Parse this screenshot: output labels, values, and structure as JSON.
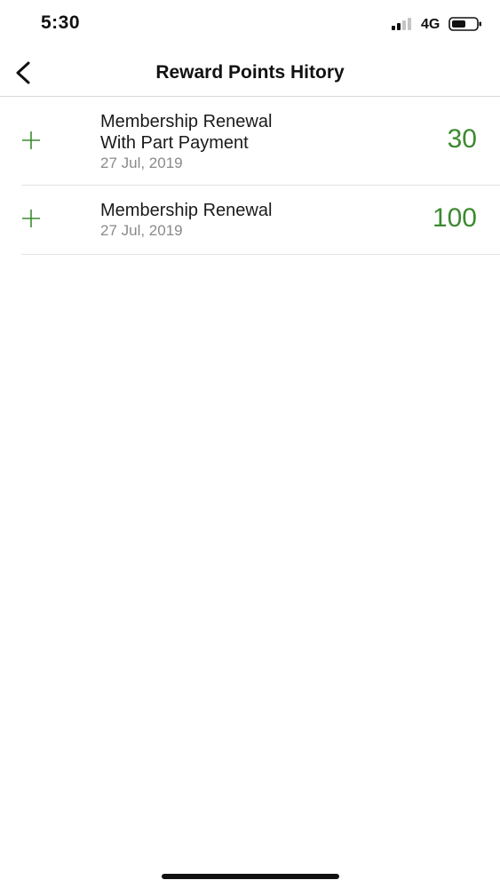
{
  "status_bar": {
    "time": "5:30",
    "network": "4G",
    "signal_icon": "signal-bars-icon",
    "battery_icon": "battery-icon"
  },
  "nav": {
    "title": "Reward Points Hitory",
    "back_icon": "chevron-left-icon"
  },
  "history": [
    {
      "title_lines": [
        "Membership Renewal",
        "With Part Payment"
      ],
      "date": "27 Jul, 2019",
      "points": "30",
      "icon": "plus-icon"
    },
    {
      "title_lines": [
        "Membership Renewal"
      ],
      "date": "27 Jul, 2019",
      "points": "100",
      "icon": "plus-icon"
    }
  ],
  "colors": {
    "points_green": "#3c8a30",
    "date_gray": "#8a8a8a",
    "divider": "#e2e2e2"
  }
}
